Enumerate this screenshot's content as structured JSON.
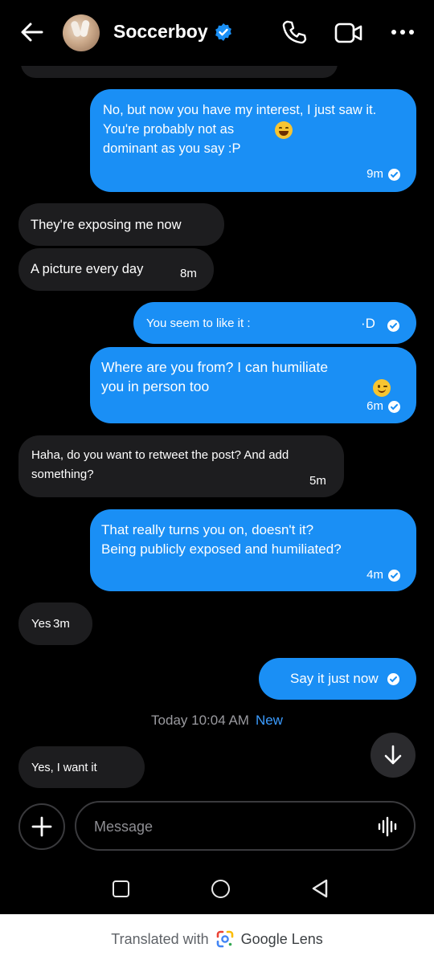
{
  "header": {
    "contact_name": "Soccerboy",
    "icons": [
      "back-arrow-icon",
      "verified-badge-icon",
      "phone-icon",
      "video-camera-icon",
      "more-options-icon"
    ]
  },
  "messages": [
    {
      "dir": "out",
      "text": "No, but now you have my interest, I just saw it.\nYou're probably not as\ndominant as you say :P",
      "time": "9m",
      "emoji": "grinning-sweat"
    },
    {
      "dir": "in",
      "text": "They're exposing me now",
      "time": ""
    },
    {
      "dir": "in",
      "text": "A picture every day",
      "time": "8m"
    },
    {
      "dir": "out",
      "text": "You seem to like it :",
      "time": "",
      "suffix": "·D"
    },
    {
      "dir": "out",
      "text": "Where are you from? I can humiliate\nyou in person too",
      "time": "6m",
      "emoji": "winking"
    },
    {
      "dir": "in",
      "text": "Haha, do you want to retweet the post? And add\nsomething?",
      "time": "5m"
    },
    {
      "dir": "out",
      "text": "That really turns you on, doesn't it?\nBeing publicly exposed and humiliated?",
      "time": "4m"
    },
    {
      "dir": "in",
      "text": "Yes",
      "time": "3m"
    },
    {
      "dir": "out",
      "text": "Say it just now",
      "time": ""
    },
    {
      "dir": "in",
      "text": "Yes, I want it",
      "time": ""
    }
  ],
  "separator": {
    "time": "Today 10:04 AM",
    "new_label": "New"
  },
  "composer": {
    "placeholder": "Message"
  },
  "footer": {
    "translated_label": "Translated with",
    "brand": "Google Lens"
  },
  "colors": {
    "outgoing_bubble": "#1a8ff5",
    "incoming_bubble": "#1d1d1f",
    "background": "#000000",
    "accent": "#3b9cff"
  }
}
